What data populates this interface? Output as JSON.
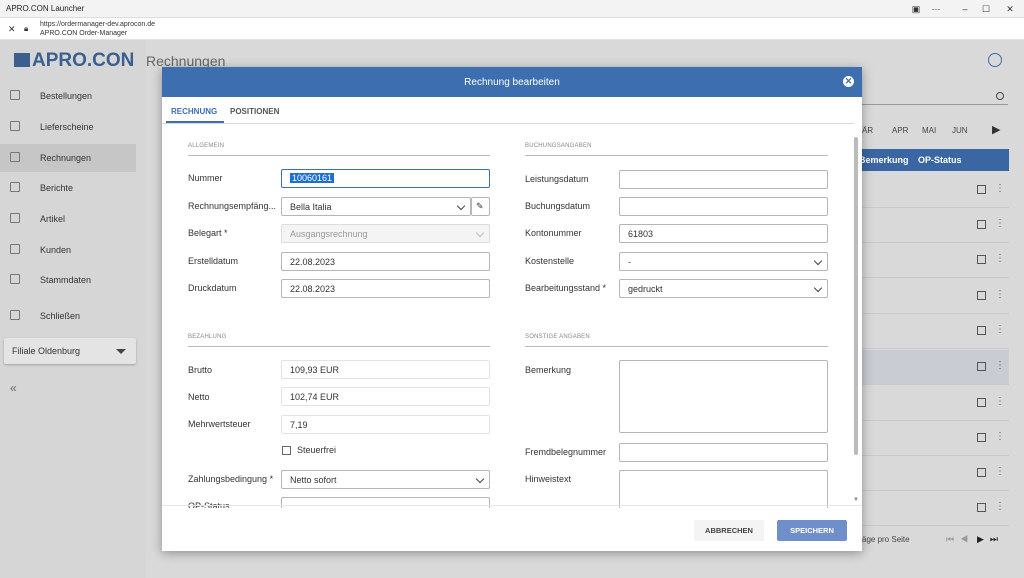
{
  "window": {
    "title": "APRO.CON Launcher"
  },
  "browser": {
    "url": "https://ordermanager-dev.aprocon.de",
    "page_title": "APRO.CON Order-Manager"
  },
  "sidebar": {
    "logo": "APRO.CON",
    "items": [
      {
        "label": "Bestellungen",
        "icon": "cart-icon"
      },
      {
        "label": "Lieferscheine",
        "icon": "document-icon"
      },
      {
        "label": "Rechnungen",
        "icon": "invoice-icon",
        "active": true
      },
      {
        "label": "Berichte",
        "icon": "chart-icon"
      },
      {
        "label": "Artikel",
        "icon": "box-icon"
      },
      {
        "label": "Kunden",
        "icon": "people-icon"
      },
      {
        "label": "Stammdaten",
        "icon": "database-icon"
      },
      {
        "label": "Schließen",
        "icon": "logout-icon"
      }
    ],
    "branch": "Filiale Oldenburg",
    "collapse": "«"
  },
  "page": {
    "title": "Rechnungen"
  },
  "background": {
    "months": [
      "ÄR",
      "APR",
      "MAI",
      "JUN"
    ],
    "col_bemerkung": "Bemerkung",
    "col_opstatus": "OP-Status",
    "pagination": "äge pro Seite"
  },
  "dialog": {
    "title": "Rechnung bearbeiten",
    "tabs": [
      "RECHNUNG",
      "POSITIONEN"
    ],
    "sections": {
      "allgemein": "ALLGEMEIN",
      "buchung": "BUCHUNGSANGABEN",
      "bezahlung": "BEZAHLUNG",
      "sonstige": "SONSTIGE ANGABEN"
    },
    "fields": {
      "nummer": {
        "label": "Nummer",
        "value": "10060161"
      },
      "empfaenger": {
        "label": "Rechnungsempfäng...",
        "value": "Bella Italia"
      },
      "belegart": {
        "label": "Belegart *",
        "value": "Ausgangsrechnung"
      },
      "erstelldatum": {
        "label": "Erstelldatum",
        "value": "22.08.2023"
      },
      "druckdatum": {
        "label": "Druckdatum",
        "value": "22.08.2023"
      },
      "leistungsdatum": {
        "label": "Leistungsdatum",
        "value": ""
      },
      "buchungsdatum": {
        "label": "Buchungsdatum",
        "value": ""
      },
      "kontonummer": {
        "label": "Kontonummer",
        "value": "61803"
      },
      "kostenstelle": {
        "label": "Kostenstelle",
        "value": "-"
      },
      "bearbeitungsstand": {
        "label": "Bearbeitungsstand *",
        "value": "gedruckt"
      },
      "brutto": {
        "label": "Brutto",
        "value": "109,93 EUR"
      },
      "netto": {
        "label": "Netto",
        "value": "102,74 EUR"
      },
      "mwst": {
        "label": "Mehrwertsteuer",
        "value": "7,19"
      },
      "steuerfrei": {
        "label": "Steuerfrei",
        "checked": false
      },
      "zahlungsbedingung": {
        "label": "Zahlungsbedingung *",
        "value": "Netto sofort"
      },
      "opstatus": {
        "label": "OP-Status",
        "value": ""
      },
      "bemerkung": {
        "label": "Bemerkung",
        "value": ""
      },
      "fremdbelegnummer": {
        "label": "Fremdbelegnummer",
        "value": ""
      },
      "hinweistext": {
        "label": "Hinweistext",
        "value": ""
      }
    },
    "buttons": {
      "cancel": "ABBRECHEN",
      "save": "SPEICHERN"
    }
  },
  "colors": {
    "primary": "#3d6fb0",
    "save_button": "#6f8fcb",
    "header_row": "#3b66a4"
  }
}
